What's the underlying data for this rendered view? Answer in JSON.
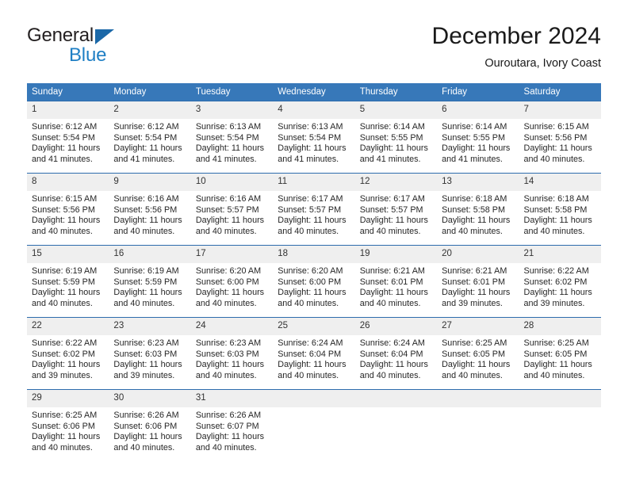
{
  "brand": {
    "name_top": "General",
    "name_bottom": "Blue",
    "triangle_icon": "brand-triangle-icon",
    "color_dark": "#231f20",
    "color_blue": "#1f7fc4",
    "triangle_color": "#1b68a8"
  },
  "header": {
    "month_title": "December 2024",
    "location": "Ouroutara, Ivory Coast"
  },
  "theme": {
    "header_bg": "#3778b9",
    "header_text": "#ffffff",
    "daynum_bg": "#efefef",
    "row_divider": "#2d6cad"
  },
  "calendar": {
    "weekday_headers": [
      "Sunday",
      "Monday",
      "Tuesday",
      "Wednesday",
      "Thursday",
      "Friday",
      "Saturday"
    ],
    "weeks": [
      [
        {
          "day": "1",
          "sunrise": "Sunrise: 6:12 AM",
          "sunset": "Sunset: 5:54 PM",
          "daylight1": "Daylight: 11 hours",
          "daylight2": "and 41 minutes."
        },
        {
          "day": "2",
          "sunrise": "Sunrise: 6:12 AM",
          "sunset": "Sunset: 5:54 PM",
          "daylight1": "Daylight: 11 hours",
          "daylight2": "and 41 minutes."
        },
        {
          "day": "3",
          "sunrise": "Sunrise: 6:13 AM",
          "sunset": "Sunset: 5:54 PM",
          "daylight1": "Daylight: 11 hours",
          "daylight2": "and 41 minutes."
        },
        {
          "day": "4",
          "sunrise": "Sunrise: 6:13 AM",
          "sunset": "Sunset: 5:54 PM",
          "daylight1": "Daylight: 11 hours",
          "daylight2": "and 41 minutes."
        },
        {
          "day": "5",
          "sunrise": "Sunrise: 6:14 AM",
          "sunset": "Sunset: 5:55 PM",
          "daylight1": "Daylight: 11 hours",
          "daylight2": "and 41 minutes."
        },
        {
          "day": "6",
          "sunrise": "Sunrise: 6:14 AM",
          "sunset": "Sunset: 5:55 PM",
          "daylight1": "Daylight: 11 hours",
          "daylight2": "and 41 minutes."
        },
        {
          "day": "7",
          "sunrise": "Sunrise: 6:15 AM",
          "sunset": "Sunset: 5:56 PM",
          "daylight1": "Daylight: 11 hours",
          "daylight2": "and 40 minutes."
        }
      ],
      [
        {
          "day": "8",
          "sunrise": "Sunrise: 6:15 AM",
          "sunset": "Sunset: 5:56 PM",
          "daylight1": "Daylight: 11 hours",
          "daylight2": "and 40 minutes."
        },
        {
          "day": "9",
          "sunrise": "Sunrise: 6:16 AM",
          "sunset": "Sunset: 5:56 PM",
          "daylight1": "Daylight: 11 hours",
          "daylight2": "and 40 minutes."
        },
        {
          "day": "10",
          "sunrise": "Sunrise: 6:16 AM",
          "sunset": "Sunset: 5:57 PM",
          "daylight1": "Daylight: 11 hours",
          "daylight2": "and 40 minutes."
        },
        {
          "day": "11",
          "sunrise": "Sunrise: 6:17 AM",
          "sunset": "Sunset: 5:57 PM",
          "daylight1": "Daylight: 11 hours",
          "daylight2": "and 40 minutes."
        },
        {
          "day": "12",
          "sunrise": "Sunrise: 6:17 AM",
          "sunset": "Sunset: 5:57 PM",
          "daylight1": "Daylight: 11 hours",
          "daylight2": "and 40 minutes."
        },
        {
          "day": "13",
          "sunrise": "Sunrise: 6:18 AM",
          "sunset": "Sunset: 5:58 PM",
          "daylight1": "Daylight: 11 hours",
          "daylight2": "and 40 minutes."
        },
        {
          "day": "14",
          "sunrise": "Sunrise: 6:18 AM",
          "sunset": "Sunset: 5:58 PM",
          "daylight1": "Daylight: 11 hours",
          "daylight2": "and 40 minutes."
        }
      ],
      [
        {
          "day": "15",
          "sunrise": "Sunrise: 6:19 AM",
          "sunset": "Sunset: 5:59 PM",
          "daylight1": "Daylight: 11 hours",
          "daylight2": "and 40 minutes."
        },
        {
          "day": "16",
          "sunrise": "Sunrise: 6:19 AM",
          "sunset": "Sunset: 5:59 PM",
          "daylight1": "Daylight: 11 hours",
          "daylight2": "and 40 minutes."
        },
        {
          "day": "17",
          "sunrise": "Sunrise: 6:20 AM",
          "sunset": "Sunset: 6:00 PM",
          "daylight1": "Daylight: 11 hours",
          "daylight2": "and 40 minutes."
        },
        {
          "day": "18",
          "sunrise": "Sunrise: 6:20 AM",
          "sunset": "Sunset: 6:00 PM",
          "daylight1": "Daylight: 11 hours",
          "daylight2": "and 40 minutes."
        },
        {
          "day": "19",
          "sunrise": "Sunrise: 6:21 AM",
          "sunset": "Sunset: 6:01 PM",
          "daylight1": "Daylight: 11 hours",
          "daylight2": "and 40 minutes."
        },
        {
          "day": "20",
          "sunrise": "Sunrise: 6:21 AM",
          "sunset": "Sunset: 6:01 PM",
          "daylight1": "Daylight: 11 hours",
          "daylight2": "and 39 minutes."
        },
        {
          "day": "21",
          "sunrise": "Sunrise: 6:22 AM",
          "sunset": "Sunset: 6:02 PM",
          "daylight1": "Daylight: 11 hours",
          "daylight2": "and 39 minutes."
        }
      ],
      [
        {
          "day": "22",
          "sunrise": "Sunrise: 6:22 AM",
          "sunset": "Sunset: 6:02 PM",
          "daylight1": "Daylight: 11 hours",
          "daylight2": "and 39 minutes."
        },
        {
          "day": "23",
          "sunrise": "Sunrise: 6:23 AM",
          "sunset": "Sunset: 6:03 PM",
          "daylight1": "Daylight: 11 hours",
          "daylight2": "and 39 minutes."
        },
        {
          "day": "24",
          "sunrise": "Sunrise: 6:23 AM",
          "sunset": "Sunset: 6:03 PM",
          "daylight1": "Daylight: 11 hours",
          "daylight2": "and 40 minutes."
        },
        {
          "day": "25",
          "sunrise": "Sunrise: 6:24 AM",
          "sunset": "Sunset: 6:04 PM",
          "daylight1": "Daylight: 11 hours",
          "daylight2": "and 40 minutes."
        },
        {
          "day": "26",
          "sunrise": "Sunrise: 6:24 AM",
          "sunset": "Sunset: 6:04 PM",
          "daylight1": "Daylight: 11 hours",
          "daylight2": "and 40 minutes."
        },
        {
          "day": "27",
          "sunrise": "Sunrise: 6:25 AM",
          "sunset": "Sunset: 6:05 PM",
          "daylight1": "Daylight: 11 hours",
          "daylight2": "and 40 minutes."
        },
        {
          "day": "28",
          "sunrise": "Sunrise: 6:25 AM",
          "sunset": "Sunset: 6:05 PM",
          "daylight1": "Daylight: 11 hours",
          "daylight2": "and 40 minutes."
        }
      ],
      [
        {
          "day": "29",
          "sunrise": "Sunrise: 6:25 AM",
          "sunset": "Sunset: 6:06 PM",
          "daylight1": "Daylight: 11 hours",
          "daylight2": "and 40 minutes."
        },
        {
          "day": "30",
          "sunrise": "Sunrise: 6:26 AM",
          "sunset": "Sunset: 6:06 PM",
          "daylight1": "Daylight: 11 hours",
          "daylight2": "and 40 minutes."
        },
        {
          "day": "31",
          "sunrise": "Sunrise: 6:26 AM",
          "sunset": "Sunset: 6:07 PM",
          "daylight1": "Daylight: 11 hours",
          "daylight2": "and 40 minutes."
        },
        {
          "day": "",
          "sunrise": "",
          "sunset": "",
          "daylight1": "",
          "daylight2": ""
        },
        {
          "day": "",
          "sunrise": "",
          "sunset": "",
          "daylight1": "",
          "daylight2": ""
        },
        {
          "day": "",
          "sunrise": "",
          "sunset": "",
          "daylight1": "",
          "daylight2": ""
        },
        {
          "day": "",
          "sunrise": "",
          "sunset": "",
          "daylight1": "",
          "daylight2": ""
        }
      ]
    ]
  }
}
